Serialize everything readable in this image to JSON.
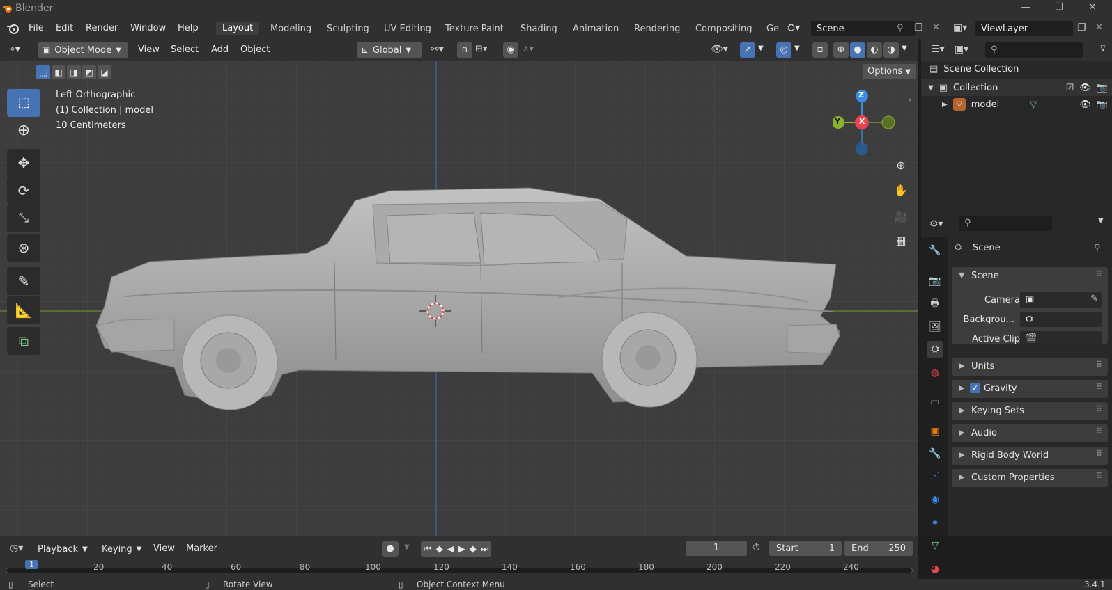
{
  "app": {
    "title": "Blender",
    "version": "3.4.1"
  },
  "menu": [
    "File",
    "Edit",
    "Render",
    "Window",
    "Help"
  ],
  "workspaces": [
    "Layout",
    "Modeling",
    "Sculpting",
    "UV Editing",
    "Texture Paint",
    "Shading",
    "Animation",
    "Rendering",
    "Compositing",
    "Ge"
  ],
  "scene_field": "Scene",
  "viewlayer_field": "ViewLayer",
  "header3d": {
    "mode": "Object Mode",
    "view": "View",
    "select": "Select",
    "add": "Add",
    "object": "Object",
    "transform": "Global",
    "options": "Options"
  },
  "viewport": {
    "view_name": "Left Orthographic",
    "collection_line": "(1) Collection | model",
    "scale": "10 Centimeters",
    "axes": {
      "z": "Z",
      "y": "Y",
      "x": "X"
    }
  },
  "outliner": {
    "scene_collection": "Scene Collection",
    "collection": "Collection",
    "object": "model"
  },
  "properties": {
    "title": "Scene",
    "section": "Scene",
    "camera": "Camera",
    "background": "Backgrou...",
    "active_clip": "Active Clip",
    "panels": [
      "Units",
      "Gravity",
      "Keying Sets",
      "Audio",
      "Rigid Body World",
      "Custom Properties"
    ]
  },
  "timeline": {
    "playback": "Playback",
    "keying": "Keying",
    "view": "View",
    "marker": "Marker",
    "frame": "1",
    "start_label": "Start",
    "start": "1",
    "end_label": "End",
    "end": "250",
    "ticks": [
      "20",
      "40",
      "60",
      "80",
      "100",
      "120",
      "140",
      "160",
      "180",
      "200",
      "220",
      "240"
    ],
    "current": "1"
  },
  "status": {
    "select": "Select",
    "rotate": "Rotate View",
    "context": "Object Context Menu"
  },
  "colors": {
    "accent": "#4772b3",
    "x_axis": "#e8434e",
    "y_axis": "#8cb12e",
    "z_axis": "#3b8ce0"
  }
}
